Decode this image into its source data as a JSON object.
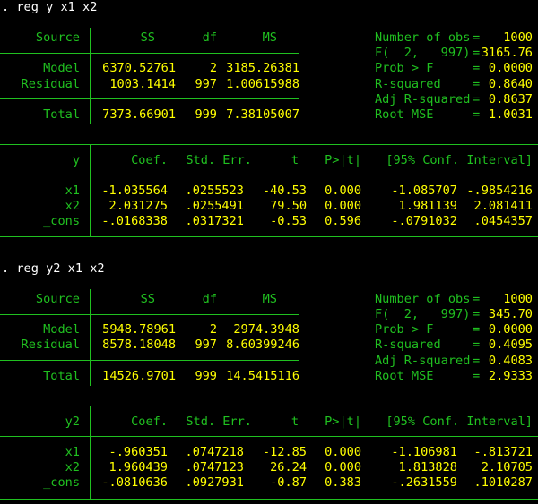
{
  "colors": {
    "background": "#000000",
    "label": "#20c020",
    "value": "#ffff00",
    "command": "#ffffff"
  },
  "reg1": {
    "command": ". reg y x1 x2",
    "anova_head": {
      "source": "Source",
      "ss": "SS",
      "df": "df",
      "ms": "MS"
    },
    "anova_rows": [
      {
        "source": "Model",
        "ss": "6370.52761",
        "df": "2",
        "ms": "3185.26381"
      },
      {
        "source": "Residual",
        "ss": "1003.1414",
        "df": "997",
        "ms": "1.00615988"
      },
      {
        "source": "Total",
        "ss": "7373.66901",
        "df": "999",
        "ms": "7.38105007"
      }
    ],
    "stats": [
      {
        "label": "Number of obs",
        "eq": "=",
        "value": "1000"
      },
      {
        "label": "F(  2,   997)",
        "eq": "=",
        "value": "3165.76"
      },
      {
        "label": "Prob > F",
        "eq": "=",
        "value": "0.0000"
      },
      {
        "label": "R-squared",
        "eq": "=",
        "value": "0.8640"
      },
      {
        "label": "Adj R-squared",
        "eq": "=",
        "value": "0.8637"
      },
      {
        "label": "Root MSE",
        "eq": "=",
        "value": "1.0031"
      }
    ],
    "coef_head": {
      "var": "y",
      "coef": "Coef.",
      "se": "Std. Err.",
      "t": "t",
      "p": "P>|t|",
      "ci": "[95% Conf. Interval]"
    },
    "coef_rows": [
      {
        "var": "x1",
        "coef": "-1.035564",
        "se": ".0255523",
        "t": "-40.53",
        "p": "0.000",
        "lo": "-1.085707",
        "hi": "-.9854216"
      },
      {
        "var": "x2",
        "coef": "2.031275",
        "se": ".0255491",
        "t": "79.50",
        "p": "0.000",
        "lo": "1.981139",
        "hi": "2.081411"
      },
      {
        "var": "_cons",
        "coef": "-.0168338",
        "se": ".0317321",
        "t": "-0.53",
        "p": "0.596",
        "lo": "-.0791032",
        "hi": ".0454357"
      }
    ]
  },
  "reg2": {
    "command": ". reg y2 x1 x2",
    "anova_head": {
      "source": "Source",
      "ss": "SS",
      "df": "df",
      "ms": "MS"
    },
    "anova_rows": [
      {
        "source": "Model",
        "ss": "5948.78961",
        "df": "2",
        "ms": "2974.3948"
      },
      {
        "source": "Residual",
        "ss": "8578.18048",
        "df": "997",
        "ms": "8.60399246"
      },
      {
        "source": "Total",
        "ss": "14526.9701",
        "df": "999",
        "ms": "14.5415116"
      }
    ],
    "stats": [
      {
        "label": "Number of obs",
        "eq": "=",
        "value": "1000"
      },
      {
        "label": "F(  2,   997)",
        "eq": "=",
        "value": "345.70"
      },
      {
        "label": "Prob > F",
        "eq": "=",
        "value": "0.0000"
      },
      {
        "label": "R-squared",
        "eq": "=",
        "value": "0.4095"
      },
      {
        "label": "Adj R-squared",
        "eq": "=",
        "value": "0.4083"
      },
      {
        "label": "Root MSE",
        "eq": "=",
        "value": "2.9333"
      }
    ],
    "coef_head": {
      "var": "y2",
      "coef": "Coef.",
      "se": "Std. Err.",
      "t": "t",
      "p": "P>|t|",
      "ci": "[95% Conf. Interval]"
    },
    "coef_rows": [
      {
        "var": "x1",
        "coef": "-.960351",
        "se": ".0747218",
        "t": "-12.85",
        "p": "0.000",
        "lo": "-1.106981",
        "hi": "-.813721"
      },
      {
        "var": "x2",
        "coef": "1.960439",
        "se": ".0747123",
        "t": "26.24",
        "p": "0.000",
        "lo": "1.813828",
        "hi": "2.10705"
      },
      {
        "var": "_cons",
        "coef": "-.0810636",
        "se": ".0927931",
        "t": "-0.87",
        "p": "0.383",
        "lo": "-.2631559",
        "hi": ".1010287"
      }
    ]
  }
}
